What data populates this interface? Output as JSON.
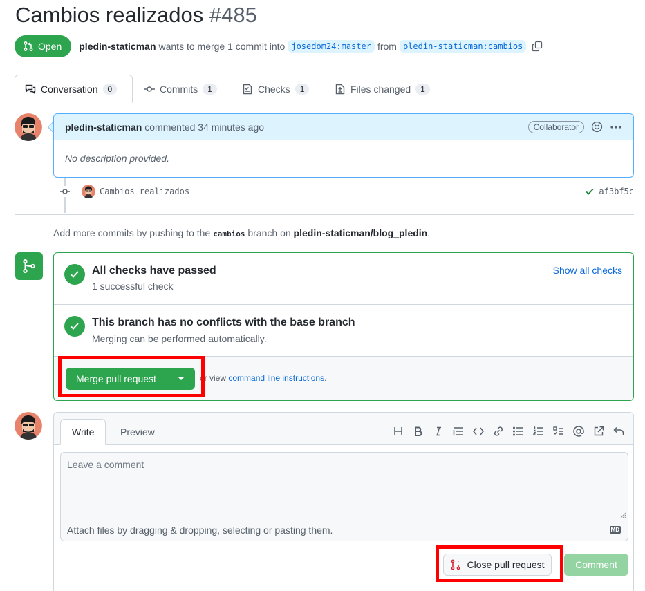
{
  "pr": {
    "title": "Cambios realizados",
    "number": "#485",
    "state": "Open",
    "author": "pledin-staticman",
    "merge_text": "wants to merge 1 commit into",
    "base_branch": "josedom24:master",
    "from_text": "from",
    "head_branch": "pledin-staticman:cambios"
  },
  "tabs": [
    {
      "label": "Conversation",
      "count": "0",
      "icon": "comment-discussion-icon"
    },
    {
      "label": "Commits",
      "count": "1",
      "icon": "git-commit-icon"
    },
    {
      "label": "Checks",
      "count": "1",
      "icon": "checklist-icon"
    },
    {
      "label": "Files changed",
      "count": "1",
      "icon": "file-diff-icon"
    }
  ],
  "comment": {
    "author": "pledin-staticman",
    "action": "commented 34 minutes ago",
    "role": "Collaborator",
    "body": "No description provided."
  },
  "commit": {
    "message": "Cambios realizados",
    "sha": "af3bf5c"
  },
  "push_note": {
    "prefix": "Add more commits by pushing to the",
    "branch": "cambios",
    "middle": "branch on",
    "repo": "pledin-staticman/blog_pledin",
    "suffix": "."
  },
  "merge_box": {
    "checks_title": "All checks have passed",
    "checks_sub": "1 successful check",
    "show_checks": "Show all checks",
    "conflict_title": "This branch has no conflicts with the base branch",
    "conflict_sub": "Merging can be performed automatically.",
    "merge_button": "Merge pull request",
    "cli_prefix": "or view",
    "cli_link": "command line instructions",
    "cli_suffix": "."
  },
  "editor": {
    "tab_write": "Write",
    "tab_preview": "Preview",
    "placeholder": "Leave a comment",
    "attach": "Attach files by dragging & dropping, selecting or pasting them.",
    "md_badge": "MD",
    "close_button": "Close pull request",
    "comment_button": "Comment"
  },
  "colors": {
    "open_green": "#2da44e",
    "link_blue": "#0969da",
    "highlight_red": "#ff0000",
    "comment_header": "#ddf4ff"
  }
}
